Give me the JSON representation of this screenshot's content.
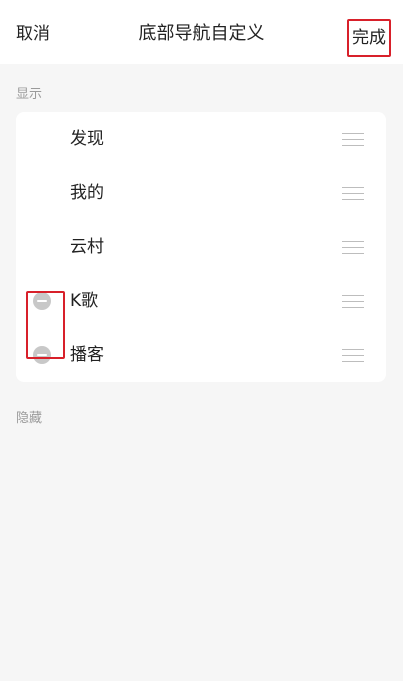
{
  "header": {
    "cancel_label": "取消",
    "title": "底部导航自定义",
    "done_label": "完成"
  },
  "sections": {
    "shown_label": "显示",
    "hidden_label": "隐藏"
  },
  "shown_items": [
    {
      "label": "发现",
      "removable": false
    },
    {
      "label": "我的",
      "removable": false
    },
    {
      "label": "云村",
      "removable": false
    },
    {
      "label": "K歌",
      "removable": true
    },
    {
      "label": "播客",
      "removable": true
    }
  ],
  "colors": {
    "highlight": "#d8202a",
    "minus_icon": "#c8c8c8",
    "background": "#f6f6f6"
  }
}
